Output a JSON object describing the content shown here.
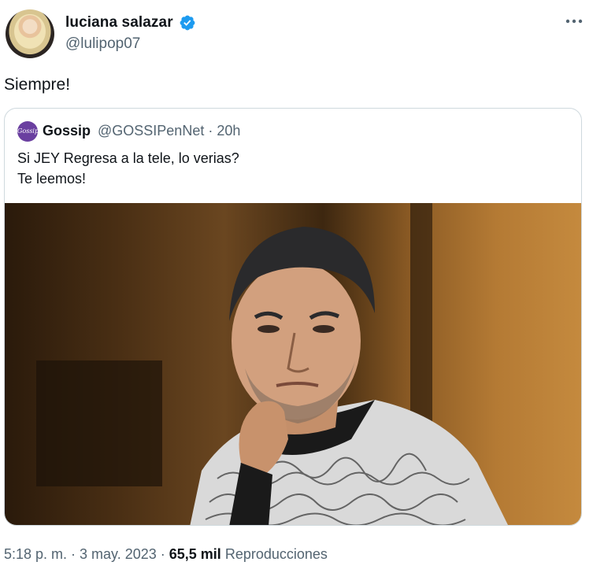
{
  "author": {
    "display_name": "luciana salazar",
    "handle": "@lulipop07"
  },
  "tweet": {
    "text": "Siempre!"
  },
  "quote": {
    "avatar_text": "Gossip",
    "name": "Gossip",
    "handle_time": "@GOSSIPenNet · 20h",
    "line1": "Si JEY Regresa a la tele, lo verias?",
    "line2": "Te leemos!"
  },
  "footer": {
    "datetime": "5:18 p. m. · 3 may. 2023 · ",
    "views_count": "65,5 mil",
    "views_label": " Reproducciones"
  },
  "colors": {
    "verified_blue": "#1d9bf0",
    "secondary_text": "#536471",
    "border": "#cfd9de"
  },
  "icons": {
    "verified": "verified-badge-icon",
    "more": "more-dots-icon"
  }
}
